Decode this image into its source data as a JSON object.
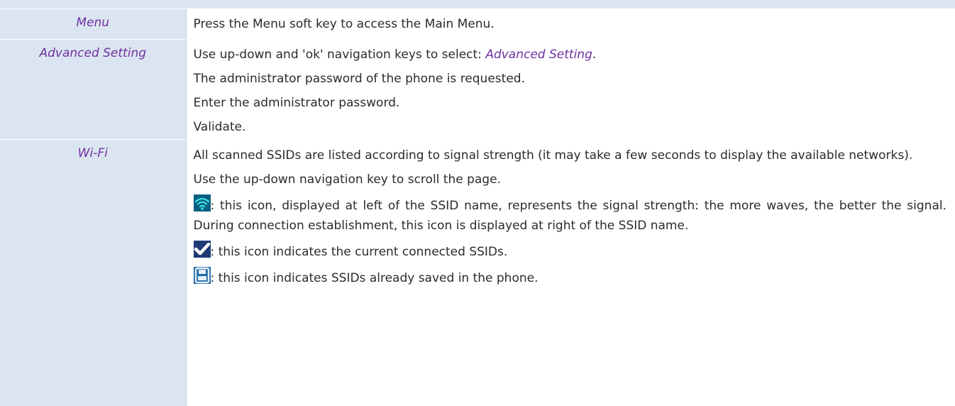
{
  "rows": [
    {
      "key": "Menu",
      "lines": [
        "Press the Menu soft key to access the Main Menu."
      ]
    },
    {
      "key": "Advanced Setting",
      "line1_prefix": "Use up-down and 'ok' navigation keys to select: ",
      "line1_term": "Advanced Setting",
      "line1_suffix": ".",
      "lines": [
        "The administrator password of the phone is requested.",
        "Enter the administrator password.",
        "Validate."
      ]
    },
    {
      "key": "Wi-Fi",
      "lines": [
        "All scanned SSIDs are listed according to signal strength (it may take a few seconds to display the available networks).",
        "Use the up-down navigation key to scroll the page.",
        ": this icon, displayed at left of the SSID name, represents the signal strength: the more waves, the better the signal. During connection establishment, this icon is displayed at right of the SSID name.",
        ": this icon indicates the current connected SSIDs.",
        ": this icon indicates SSIDs already saved in the phone."
      ],
      "icons": [
        "wifi-signal-icon",
        "check-icon",
        "floppy-save-icon"
      ]
    }
  ],
  "colors": {
    "key_background": "#dbe5f1",
    "term_text": "#7030a0",
    "body_text": "#2b2b2b"
  }
}
